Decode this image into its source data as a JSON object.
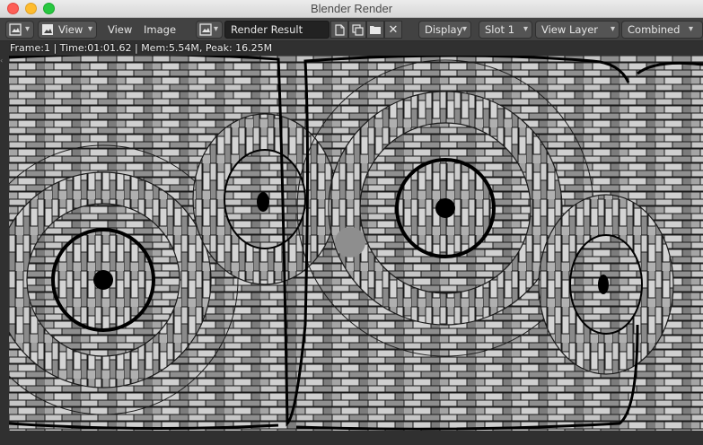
{
  "window": {
    "title": "Blender Render"
  },
  "header": {
    "editor_type_icon": "image-editor-icon",
    "view_menu_label": "View",
    "menu_view": "View",
    "menu_image": "Image",
    "image_browse_icon": "image-browse-icon",
    "image_name": "Render Result",
    "display_label": "Display",
    "slot_label": "Slot 1",
    "view_layer_label": "View Layer",
    "pass_label": "Combined"
  },
  "stats": {
    "text": "Frame:1 | Time:01:01.62 | Mem:5.54M, Peak: 16.25M"
  },
  "render": {
    "description_icon": "render-result-image"
  },
  "colors": {
    "header_bg": "#424242",
    "button_bg": "#545454",
    "field_bg": "#222222",
    "viewport_bg": "#303030"
  }
}
